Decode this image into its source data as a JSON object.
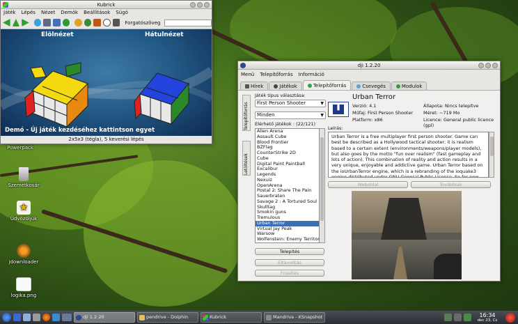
{
  "desktop": {
    "icons": [
      {
        "label": "Frissítés Powerpack",
        "icon": "package-icon"
      },
      {
        "label": "Szemétkosár",
        "icon": "trash-icon"
      },
      {
        "label": "Üdvözöljük",
        "icon": "star-icon"
      },
      {
        "label": "jdownloader",
        "icon": "download-icon"
      },
      {
        "label": "logika.png",
        "icon": "image-icon"
      }
    ]
  },
  "kubrick": {
    "title": "Kubrick",
    "menu": [
      "Játék",
      "Lépés",
      "Nézet",
      "Demók",
      "Beállítások",
      "Súgó"
    ],
    "toolbar": {
      "rotation_label": "Forgatószöveg"
    },
    "front_view_label": "Elölnézet",
    "back_view_label": "Hátulnézet",
    "demo_text": "Demó - Új játék kezdéséhez kattintson egyet",
    "status": "2x5x3 (tégla), 5 keverési lépés"
  },
  "dji": {
    "title": "dji 1.2.20",
    "menu": [
      "Menü",
      "Telepítőforrás",
      "Információ"
    ],
    "tabs": [
      {
        "label": "Hírek",
        "icon": "news-icon"
      },
      {
        "label": "Játékok",
        "icon": "games-icon"
      },
      {
        "label": "Telepítőforrás",
        "icon": "source-icon",
        "active": true
      },
      {
        "label": "Csevegés",
        "icon": "chat-icon"
      },
      {
        "label": "Modulok",
        "icon": "modules-icon"
      }
    ],
    "side_tabs": [
      "Telepítőforrás",
      "Letöltések"
    ],
    "type_label": "Játék típus választása:",
    "type_value": "First Person Shooter",
    "filter_value": "Minden",
    "available_label": "Elérhető játékok : (22/121)",
    "games": [
      "Alien Arena",
      "Assault Cube",
      "Blood Frontier",
      "BZFlag",
      "CounterStrike 2D",
      "Cube",
      "Digital Paint Paintball",
      "Excalibur",
      "Legends",
      "Nexuiz",
      "OpenArena",
      "Postal 2: Share The Pain",
      "Sauerbraten",
      "Savage 2 : A Tortured Soul",
      "Skulltag",
      "Smokin guns",
      "Tremulous",
      "Urban Terror",
      "Virtual Jay Peak",
      "Warsow",
      "Wolfenstein: Enemy Territory"
    ],
    "selected_game": "Urban Terror",
    "buttons": {
      "install": "Telepítés",
      "remove": "Eltávolítás",
      "update": "Frissítés",
      "website": "Weboldal",
      "more": "Továbbiak"
    },
    "game": {
      "name": "Urban Terror",
      "version": "Verzió: 4.1",
      "genre": "Műfaj: First Person Shooter",
      "platform": "Platform: x86",
      "state": "Állapota: Nincs telepítve",
      "size": "Méret: ~719 Mo",
      "license": "Licence: General public licence (gpl)",
      "desc_label": "Leírás:",
      "description": "Urban Terror is a free multiplayer first person shooter. Game can best be described as a Hollywood tactical shooter; it is realism based to a certain extent (environments/weapons/player models), but also goes by the motto \"fun over realism\" (fast gameplay and lots of action). This combination of reality and action results in a very unique, enjoyable and addictive game. Urban Terror based on the ioUrbanTerror engine, which is a rebranding of the ioquake3 engine distributed under GNU General Public License. So for now"
    }
  },
  "taskbar": {
    "tasks": [
      {
        "label": "dji 1.2.20",
        "active": true
      },
      {
        "label": "pendrive - Dolphin",
        "active": false
      },
      {
        "label": "Kubrick",
        "active": false
      },
      {
        "label": "Mandriva - KSnapshot",
        "active": false
      }
    ],
    "clock_time": "16:34",
    "clock_date": "dec 23, Cs"
  },
  "colors": {
    "selection": "#3a6fb5",
    "kubrick_bg": "#235a86",
    "taskbar": "#2a2d32"
  }
}
